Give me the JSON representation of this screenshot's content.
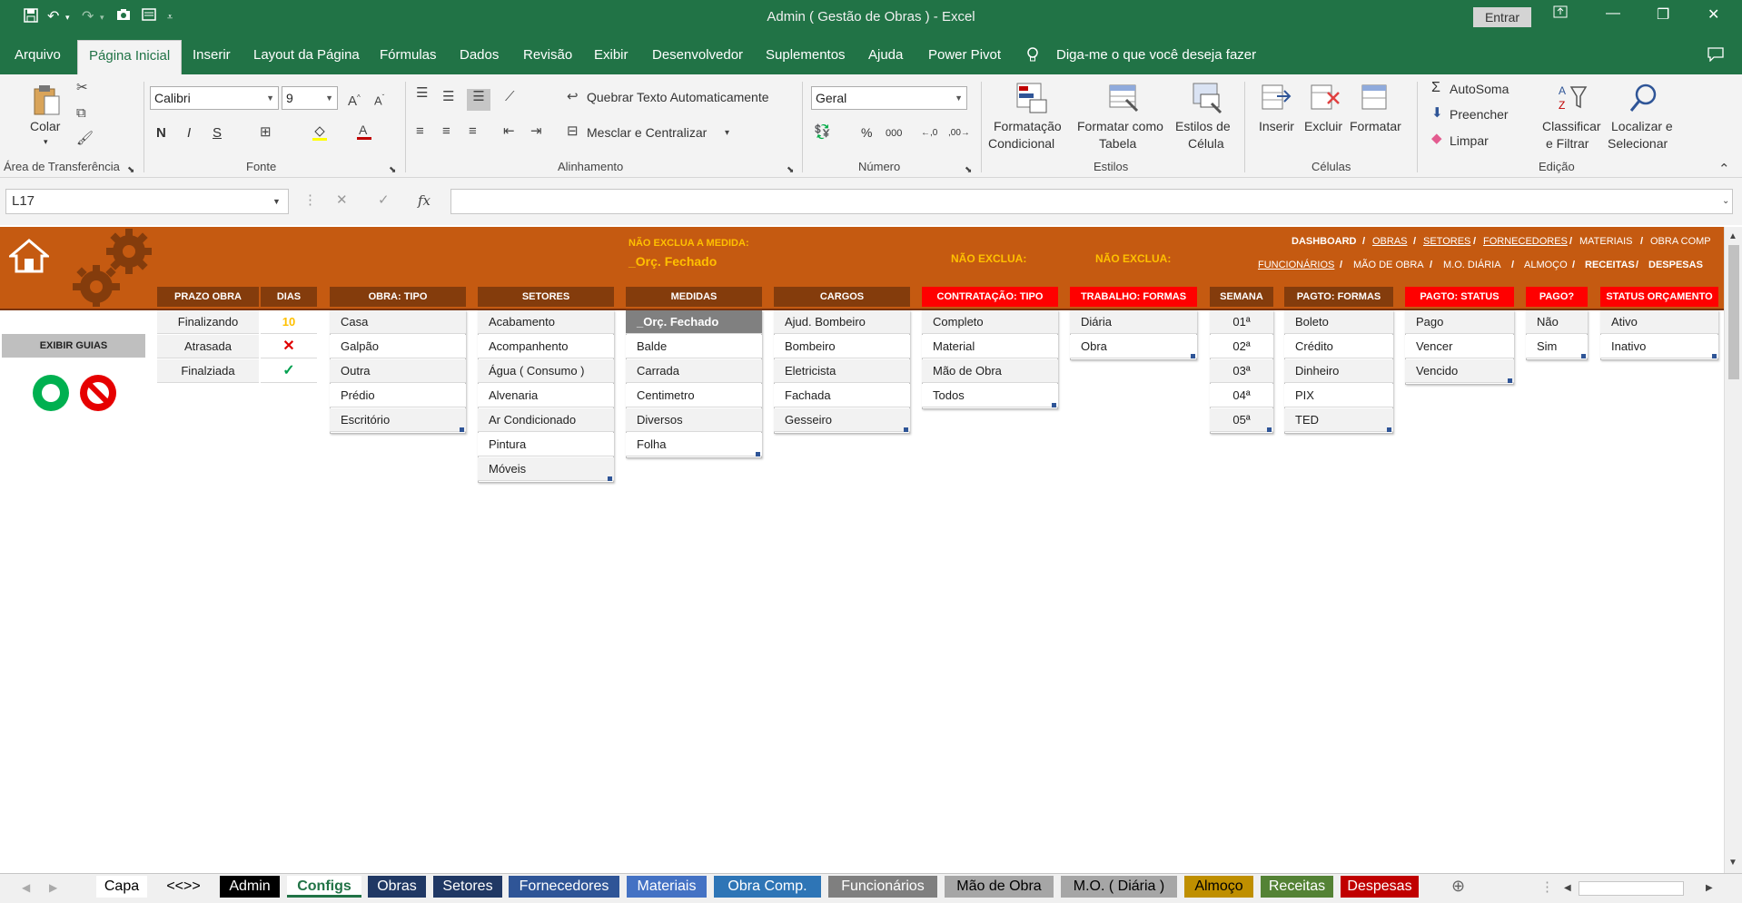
{
  "window": {
    "title": "Admin ( Gestão de Obras )  -  Excel",
    "signin_label": "Entrar"
  },
  "ribbon_tabs": [
    "Arquivo",
    "Página Inicial",
    "Inserir",
    "Layout da Página",
    "Fórmulas",
    "Dados",
    "Revisão",
    "Exibir",
    "Desenvolvedor",
    "Suplementos",
    "Ajuda",
    "Power Pivot",
    "Diga-me o que você deseja fazer"
  ],
  "ribbon": {
    "paste": "Colar",
    "font_name": "Calibri",
    "font_size": "9",
    "bold": "N",
    "italic": "I",
    "underline": "S",
    "wrap_text": "Quebrar Texto Automaticamente",
    "merge_center": "Mesclar e Centralizar",
    "number_format": "Geral",
    "cond_format_1": "Formatação",
    "cond_format_2": "Condicional",
    "format_table_1": "Formatar como",
    "format_table_2": "Tabela",
    "cell_styles_1": "Estilos de",
    "cell_styles_2": "Célula",
    "insert": "Inserir",
    "delete": "Excluir",
    "format": "Formatar",
    "autosum": "AutoSoma",
    "fill": "Preencher",
    "clear": "Limpar",
    "sort_1": "Classificar",
    "sort_2": "e Filtrar",
    "find_1": "Localizar e",
    "find_2": "Selecionar",
    "groups": {
      "clipboard": "Área de Transferência",
      "font": "Fonte",
      "alignment": "Alinhamento",
      "number": "Número",
      "styles": "Estilos",
      "cells": "Células",
      "editing": "Edição"
    }
  },
  "formula_bar": {
    "name_box": "L17",
    "formula": ""
  },
  "banner": {
    "warn_label": "NÃO EXCLUA A MEDIDA:",
    "warn_value": "_Orç. Fechado",
    "warn2": "NÃO EXCLUA:",
    "warn3": "NÃO EXCLUA:",
    "nav_row1": [
      "DASHBOARD",
      "/",
      "OBRAS",
      "/",
      "SETORES",
      "/",
      "FORNECEDORES",
      "/",
      "MATERIAIS",
      "/",
      "OBRA COMP"
    ],
    "nav_row2": [
      "FUNCIONÁRIOS",
      "/",
      "MÃO DE OBRA",
      "/",
      "M.O. DIÁRIA",
      "/",
      "ALMOÇO",
      "/",
      "RECEITAS",
      "/",
      "DESPESAS"
    ],
    "show_tabs": "EXIBIR GUIAS"
  },
  "tables": {
    "prazo": {
      "header": "PRAZO OBRA",
      "header2": "DIAS",
      "rows": [
        "Finalizando",
        "Atrasada",
        "Finalziada"
      ],
      "dias": [
        "10",
        "✕",
        "✓"
      ]
    },
    "obra_tipo": {
      "header": "OBRA: TIPO",
      "rows": [
        "Casa",
        "Galpão",
        "Outra",
        "Prédio",
        "Escritório"
      ]
    },
    "setores": {
      "header": "SETORES",
      "rows": [
        "Acabamento",
        "Acompanhento",
        "Água ( Consumo )",
        "Alvenaria",
        "Ar Condicionado",
        "Pintura",
        "Móveis"
      ]
    },
    "medidas": {
      "header": "MEDIDAS",
      "rows": [
        "_Orç. Fechado",
        "Balde",
        "Carrada",
        "Centimetro",
        "Diversos",
        "Folha"
      ]
    },
    "cargos": {
      "header": "CARGOS",
      "rows": [
        "Ajud. Bombeiro",
        "Bombeiro",
        "Eletricista",
        "Fachada",
        "Gesseiro"
      ]
    },
    "contratacao": {
      "header": "CONTRATAÇÃO: TIPO",
      "rows": [
        "Completo",
        "Material",
        "Mão de Obra",
        "Todos"
      ]
    },
    "trabalho": {
      "header": "TRABALHO: FORMAS",
      "rows": [
        "Diária",
        "Obra"
      ]
    },
    "semana": {
      "header": "SEMANA",
      "rows": [
        "01ª",
        "02ª",
        "03ª",
        "04ª",
        "05ª"
      ]
    },
    "pagto_formas": {
      "header": "PAGTO: FORMAS",
      "rows": [
        "Boleto",
        "Crédito",
        "Dinheiro",
        "PIX",
        "TED"
      ]
    },
    "pagto_status": {
      "header": "PAGTO: STATUS",
      "rows": [
        "Pago",
        "Vencer",
        "Vencido"
      ]
    },
    "pago": {
      "header": "PAGO?",
      "rows": [
        "Não",
        "Sim"
      ]
    },
    "status_orc": {
      "header": "STATUS ORÇAMENTO",
      "rows": [
        "Ativo",
        "Inativo"
      ]
    }
  },
  "sheet_tabs": [
    {
      "label": "Capa",
      "color": "#ffffff",
      "text": "#000000"
    },
    {
      "label": "<<>>",
      "color": "#f0f0f0",
      "text": "#000000"
    },
    {
      "label": "Admin",
      "color": "#000000",
      "text": "#ffffff"
    },
    {
      "label": "Configs",
      "color": "#ffffff",
      "text": "#217346"
    },
    {
      "label": "Obras",
      "color": "#203864",
      "text": "#ffffff"
    },
    {
      "label": "Setores",
      "color": "#203864",
      "text": "#ffffff"
    },
    {
      "label": "Fornecedores",
      "color": "#2f5597",
      "text": "#ffffff"
    },
    {
      "label": "Materiais",
      "color": "#4472c4",
      "text": "#ffffff"
    },
    {
      "label": "Obra Comp.",
      "color": "#2e75b6",
      "text": "#ffffff"
    },
    {
      "label": "Funcionários",
      "color": "#7f7f7f",
      "text": "#ffffff"
    },
    {
      "label": "Mão de Obra",
      "color": "#a6a6a6",
      "text": "#000000"
    },
    {
      "label": "M.O. ( Diária )",
      "color": "#a6a6a6",
      "text": "#000000"
    },
    {
      "label": "Almoço",
      "color": "#bf8f00",
      "text": "#000000"
    },
    {
      "label": "Receitas",
      "color": "#548235",
      "text": "#ffffff"
    },
    {
      "label": "Despesas",
      "color": "#c00000",
      "text": "#ffffff"
    }
  ],
  "colors": {
    "excel_green": "#217346",
    "banner_orange": "#c55a11",
    "header_brown": "#843c0c",
    "header_red": "#ff0000",
    "warn_yellow": "#ffc000"
  }
}
